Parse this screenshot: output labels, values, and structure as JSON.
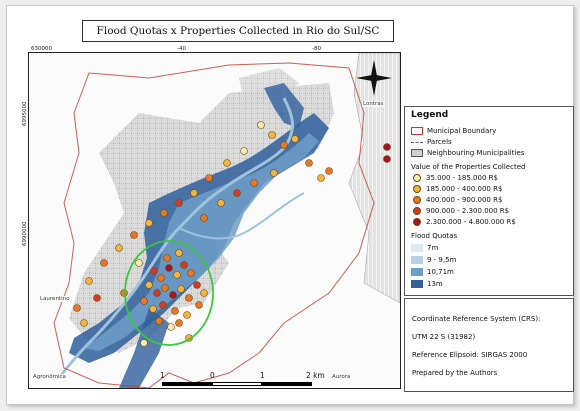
{
  "title": "Flood Quotas x Properties Collected in Rio do Sul/SC",
  "grid_ticks": {
    "top": [
      "630000",
      "-40",
      "-80"
    ],
    "left": [
      "6995000",
      "6990000"
    ]
  },
  "place_labels": [
    "Lontras",
    "Laurentino",
    "Aurora",
    "Agronômica"
  ],
  "legend": {
    "title": "Legend",
    "layers": [
      {
        "label": "Municipal Boundary",
        "symbol": "red-outline-box"
      },
      {
        "label": "Parcels",
        "symbol": "dashed-line"
      },
      {
        "label": "Neighbouring Municipalities",
        "symbol": "grey-hatched-box"
      }
    ],
    "properties_heading": "Value of the Properties Collected",
    "property_classes": [
      {
        "label": "35.000 - 185.000 R$",
        "color": "#fde9b8"
      },
      {
        "label": "185.000 - 400.000 R$",
        "color": "#f5b342"
      },
      {
        "label": "400.000 - 900.000 R$",
        "color": "#e8772a"
      },
      {
        "label": "900.000 - 2.300.000 R$",
        "color": "#d13a2a"
      },
      {
        "label": "2.300.000 - 4.800.000 R$",
        "color": "#a3132a"
      }
    ],
    "flood_heading": "Flood Quotas",
    "flood_classes": [
      {
        "label": "7m",
        "color": "#dde9f3"
      },
      {
        "label": "9 - 9,5m",
        "color": "#b7d0e7"
      },
      {
        "label": "10,71m",
        "color": "#6f9dc9"
      },
      {
        "label": "13m",
        "color": "#2e5f9b"
      }
    ]
  },
  "crs": {
    "line1": "Coordinate Reference System (CRS):",
    "line2": "UTM 22 S (31982)",
    "line3": "Reference Elipsoid: SIRGAS 2000",
    "line4": "Prepared by the Authors"
  },
  "scale": {
    "labels": [
      "1",
      "0",
      "1",
      "2 km"
    ]
  },
  "colors": {
    "highlight_circle": "#3cc63c",
    "river": "#9fc3dd",
    "boundary": "#c0392b"
  }
}
